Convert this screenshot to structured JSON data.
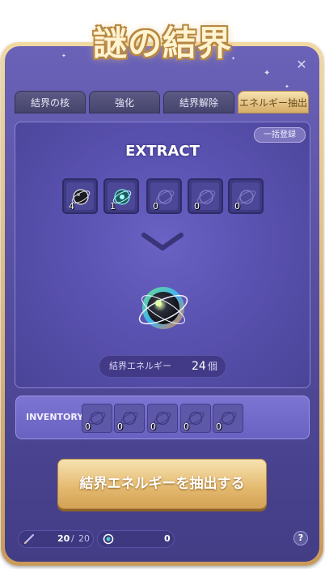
{
  "window": {
    "title": "謎の結界",
    "close_icon": "✕"
  },
  "tabs": [
    {
      "label": "結界の核",
      "active": false
    },
    {
      "label": "強化",
      "active": false
    },
    {
      "label": "結界解除",
      "active": false
    },
    {
      "label": "エネルギー抽出",
      "active": true
    }
  ],
  "extract": {
    "bulk_register_label": "一括登録",
    "title": "EXTRACT",
    "slots": [
      {
        "count": "4",
        "icon": "black-core-icon"
      },
      {
        "count": "1",
        "icon": "teal-core-icon"
      },
      {
        "count": "0",
        "icon": "empty-core-icon"
      },
      {
        "count": "0",
        "icon": "empty-core-icon"
      },
      {
        "count": "0",
        "icon": "empty-core-icon"
      }
    ],
    "arrow_icon": "chevron-down-icon",
    "result_icon": "barrier-energy-orb-icon",
    "energy_label": "結界エネルギー",
    "energy_value": "24",
    "energy_unit": "個"
  },
  "inventory": {
    "label": "INVENTORY",
    "slots": [
      {
        "count": "0"
      },
      {
        "count": "0"
      },
      {
        "count": "0"
      },
      {
        "count": "0"
      },
      {
        "count": "0"
      }
    ]
  },
  "main_button_label": "結界エネルギーを抽出する",
  "footer": {
    "attempts_current": "20",
    "attempts_sep": "/",
    "attempts_max": "20",
    "currency_value": "0",
    "help_label": "?"
  },
  "colors": {
    "accent_gold": "#e3b86d",
    "panel_purple": "#5e56a8"
  }
}
